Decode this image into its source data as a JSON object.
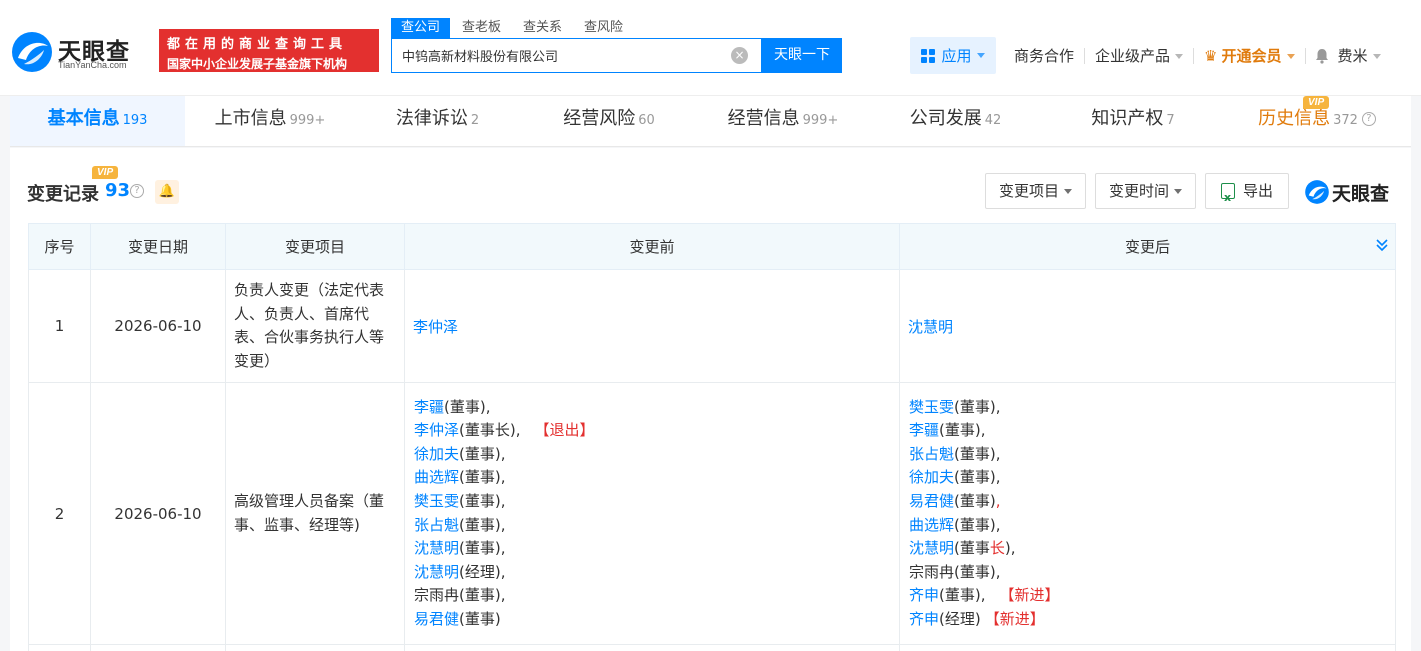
{
  "header": {
    "logo_text": "天眼查",
    "logo_sub": "TianYanCha.com",
    "slogan_line1": "都在用的商业查询工具",
    "slogan_line2": "国家中小企业发展子基金旗下机构",
    "search_tabs": [
      "查公司",
      "查老板",
      "查关系",
      "查风险"
    ],
    "search_value": "中钨高新材料股份有限公司",
    "search_button": "天眼一下",
    "nav": {
      "apps": "应用",
      "business": "商务合作",
      "enterprise": "企业级产品",
      "vip": "开通会员",
      "user": "费米"
    }
  },
  "tabs": [
    {
      "label": "基本信息",
      "count": "193"
    },
    {
      "label": "上市信息",
      "count": "999+"
    },
    {
      "label": "法律诉讼",
      "count": "2"
    },
    {
      "label": "经营风险",
      "count": "60"
    },
    {
      "label": "经营信息",
      "count": "999+"
    },
    {
      "label": "公司发展",
      "count": "42"
    },
    {
      "label": "知识产权",
      "count": "7"
    },
    {
      "label": "历史信息",
      "count": "372",
      "badge": "VIP"
    }
  ],
  "section": {
    "title": "变更记录",
    "badge": "VIP",
    "count": "93",
    "filter_item": "变更项目",
    "filter_time": "变更时间",
    "export": "导出",
    "brand": "天眼查"
  },
  "table": {
    "headers": [
      "序号",
      "变更日期",
      "变更项目",
      "变更前",
      "变更后"
    ],
    "rows": [
      {
        "index": "1",
        "date": "2026-06-10",
        "item": "负责人变更（法定代表人、负责人、首席代表、合伙事务执行人等变更）",
        "before": [
          {
            "name": "李仲泽",
            "role": "",
            "sep": "",
            "tag": ""
          }
        ],
        "after": [
          {
            "name": "沈慧明",
            "role": "",
            "sep": "",
            "tag": ""
          }
        ]
      },
      {
        "index": "2",
        "date": "2026-06-10",
        "item": "高级管理人员备案（董事、监事、经理等)",
        "before": [
          {
            "name": "李疆",
            "role": "(董事)",
            "sep": ",",
            "tag": ""
          },
          {
            "name": "李仲泽",
            "role": "(董事长)",
            "sep": ",",
            "tag": "【退出】"
          },
          {
            "name": "徐加夫",
            "role": "(董事)",
            "sep": ",",
            "tag": ""
          },
          {
            "name": "曲选辉",
            "role": "(董事)",
            "sep": ",",
            "tag": ""
          },
          {
            "name": "樊玉雯",
            "role": "(董事)",
            "sep": ",",
            "tag": ""
          },
          {
            "name": "张占魁",
            "role": "(董事)",
            "sep": ",",
            "tag": ""
          },
          {
            "name": "沈慧明",
            "role": "(董事)",
            "sep": ",",
            "tag": ""
          },
          {
            "name": "沈慧明",
            "role": "(经理)",
            "sep": ",",
            "tag": ""
          },
          {
            "name": "宗雨冉",
            "role": "(董事)",
            "sep": ",",
            "tag": "",
            "plain": true
          },
          {
            "name": "易君健",
            "role": "(董事)",
            "sep": "",
            "tag": ""
          }
        ],
        "after": [
          {
            "name": "樊玉雯",
            "role": "(董事)",
            "sep": ",",
            "tag": ""
          },
          {
            "name": "李疆",
            "role": "(董事)",
            "sep": ",",
            "tag": ""
          },
          {
            "name": "张占魁",
            "role": "(董事)",
            "sep": ",",
            "tag": ""
          },
          {
            "name": "徐加夫",
            "role": "(董事)",
            "sep": ",",
            "tag": ""
          },
          {
            "name": "易君健",
            "role": "(董事)",
            "sep": ",",
            "tag": ""
          },
          {
            "name": "曲选辉",
            "role": "(董事)",
            "sep": ",",
            "tag": ""
          },
          {
            "name": "沈慧明",
            "role": "(董事",
            "role_mark": "长",
            "role_end": ")",
            "sep": ",",
            "tag": ""
          },
          {
            "name": "宗雨冉",
            "role": "(董事)",
            "sep": ",",
            "tag": "",
            "plain": true
          },
          {
            "name": "齐申",
            "role": "(董事)",
            "sep": ",",
            "tag": "【新进】"
          },
          {
            "name": "齐申",
            "role": "(经理)",
            "sep": "",
            "tag": "【新进】"
          }
        ]
      }
    ]
  },
  "colors": {
    "brand_blue": "#0084ff",
    "slogan_red": "#e3302f",
    "vip_orange": "#e07b0c",
    "vip_badge": "#f6b43d",
    "table_header_bg": "#f2f9fc"
  }
}
